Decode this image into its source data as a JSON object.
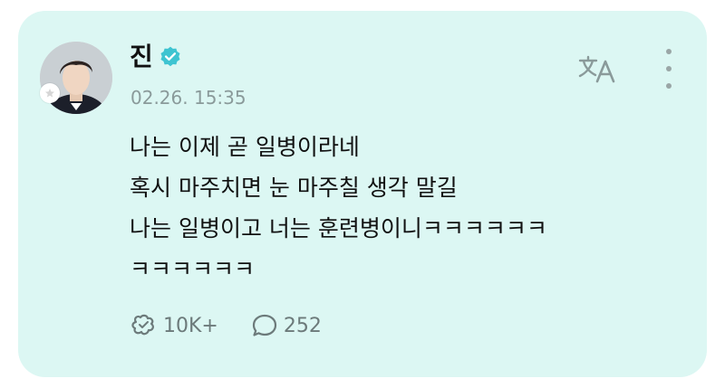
{
  "post": {
    "author": "진",
    "verified": true,
    "timestamp": "02.26. 15:35",
    "lines": [
      "나는 이제 곧 일병이라네",
      "혹시 마주치면 눈 마주칠 생각 말길",
      "나는 일병이고 너는 훈련병이니ㅋㅋㅋㅋㅋㅋ",
      "ㅋㅋㅋㅋㅋㅋ"
    ]
  },
  "actions": {
    "likes": "10K+",
    "comments": "252"
  },
  "icons": {
    "verified": "verified-check-icon",
    "translate": "translate-icon",
    "more": "more-vertical-icon",
    "like": "sparkle-heart-icon",
    "comment": "speech-bubble-icon",
    "avatar_badge": "star-icon"
  },
  "colors": {
    "card_background": "#dcf7f3",
    "verified": "#3ec4d1",
    "muted_text": "#8a9a9a"
  }
}
